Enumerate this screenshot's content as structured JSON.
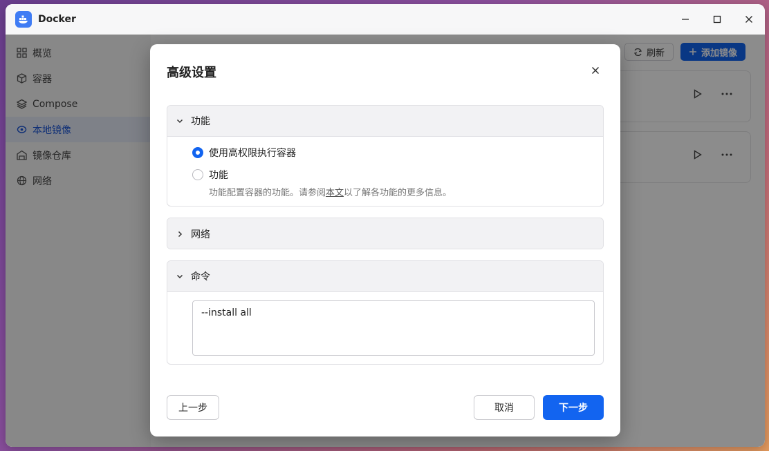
{
  "window": {
    "title": "Docker"
  },
  "sidebar": {
    "items": [
      {
        "label": "概览",
        "icon": "grid-icon"
      },
      {
        "label": "容器",
        "icon": "cube-icon"
      },
      {
        "label": "Compose",
        "icon": "layers-icon"
      },
      {
        "label": "本地镜像",
        "icon": "image-icon",
        "active": true
      },
      {
        "label": "镜像仓库",
        "icon": "warehouse-icon"
      },
      {
        "label": "网络",
        "icon": "globe-icon"
      }
    ]
  },
  "toolbar": {
    "refresh_label": "刷新",
    "add_label": "添加镜像"
  },
  "dialog": {
    "title": "高级设置",
    "sections": {
      "capabilities": {
        "title": "功能",
        "expanded": true,
        "options": [
          {
            "label": "使用高权限执行容器",
            "checked": true
          },
          {
            "label": "功能",
            "checked": false
          }
        ],
        "hint_prefix": "功能配置容器的功能。请参阅",
        "hint_link": "本文",
        "hint_suffix": "以了解各功能的更多信息。"
      },
      "network": {
        "title": "网络",
        "expanded": false
      },
      "command": {
        "title": "命令",
        "expanded": true,
        "value": "--install all"
      }
    },
    "buttons": {
      "prev": "上一步",
      "cancel": "取消",
      "next": "下一步"
    }
  },
  "colors": {
    "accent": "#1264f0",
    "active_nav_bg": "#e6ecf8",
    "active_nav_text": "#1a55d8"
  }
}
